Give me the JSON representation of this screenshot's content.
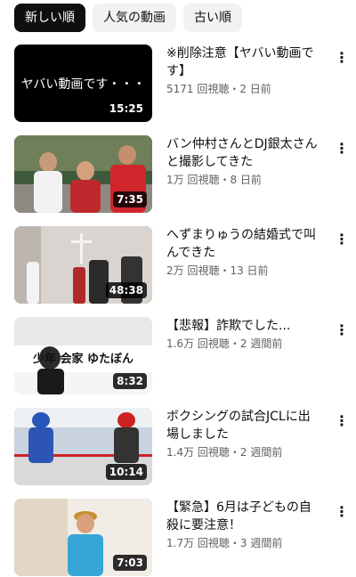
{
  "filters": {
    "newest": "新しい順",
    "popular": "人気の動画",
    "oldest": "古い順"
  },
  "videos": [
    {
      "title": "※削除注意【ヤバい動画です】",
      "stats": "5171 回視聴・2 日前",
      "duration": "15:25",
      "thumb_text": "ヤバい動画です・・・"
    },
    {
      "title": "バン仲村さんとDJ銀太さんと撮影してきた",
      "stats": "1万 回視聴・8 日前",
      "duration": "7:35"
    },
    {
      "title": "へずまりゅうの結婚式で叫んできた",
      "stats": "2万 回視聴・13 日前",
      "duration": "48:38"
    },
    {
      "title": "【悲報】詐欺でした...",
      "stats": "1.6万 回視聴・2 週間前",
      "duration": "8:32",
      "thumb_text": "少年 会家 ゆたぼん"
    },
    {
      "title": "ボクシングの試合JCLに出場しました",
      "stats": "1.4万 回視聴・2 週間前",
      "duration": "10:14"
    },
    {
      "title": "【緊急】6月は子どもの自殺に要注意！",
      "stats": "1.7万 回視聴・3 週間前",
      "duration": "7:03"
    }
  ],
  "icons": {
    "menu": "more-vert-icon"
  },
  "colors": {
    "chip_active_bg": "#0f0f0f",
    "chip_bg": "#f2f2f2",
    "secondary_text": "#606060"
  }
}
